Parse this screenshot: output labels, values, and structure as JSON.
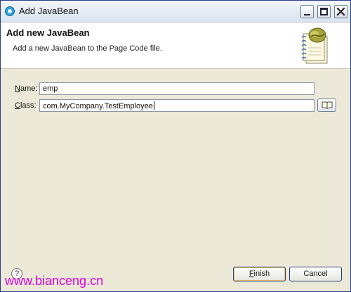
{
  "window": {
    "title": "Add JavaBean",
    "icon": "eclipse-app-icon",
    "controls": [
      "minimize-icon",
      "maximize-icon",
      "close-icon"
    ]
  },
  "header": {
    "title": "Add new JavaBean",
    "description": "Add a new JavaBean to the Page Code file.",
    "icon": "coffee-bean-notepad-icon"
  },
  "form": {
    "name_mnemonic": "N",
    "name_label_rest": "ame:",
    "name_value": "emp",
    "class_mnemonic": "C",
    "class_label_rest": "lass:",
    "class_value": "com.MyCompany.TestEmployee",
    "browse_icon": "browse-book-icon"
  },
  "footer": {
    "help_glyph": "?",
    "watermark": "www.bianceng.cn",
    "finish_mnemonic": "F",
    "finish_rest": "inish",
    "cancel_label": "Cancel"
  },
  "colors": {
    "watermark": "#e000d8",
    "title_bar": "#dfe7f1",
    "dialog_bg": "#ece9d8"
  }
}
